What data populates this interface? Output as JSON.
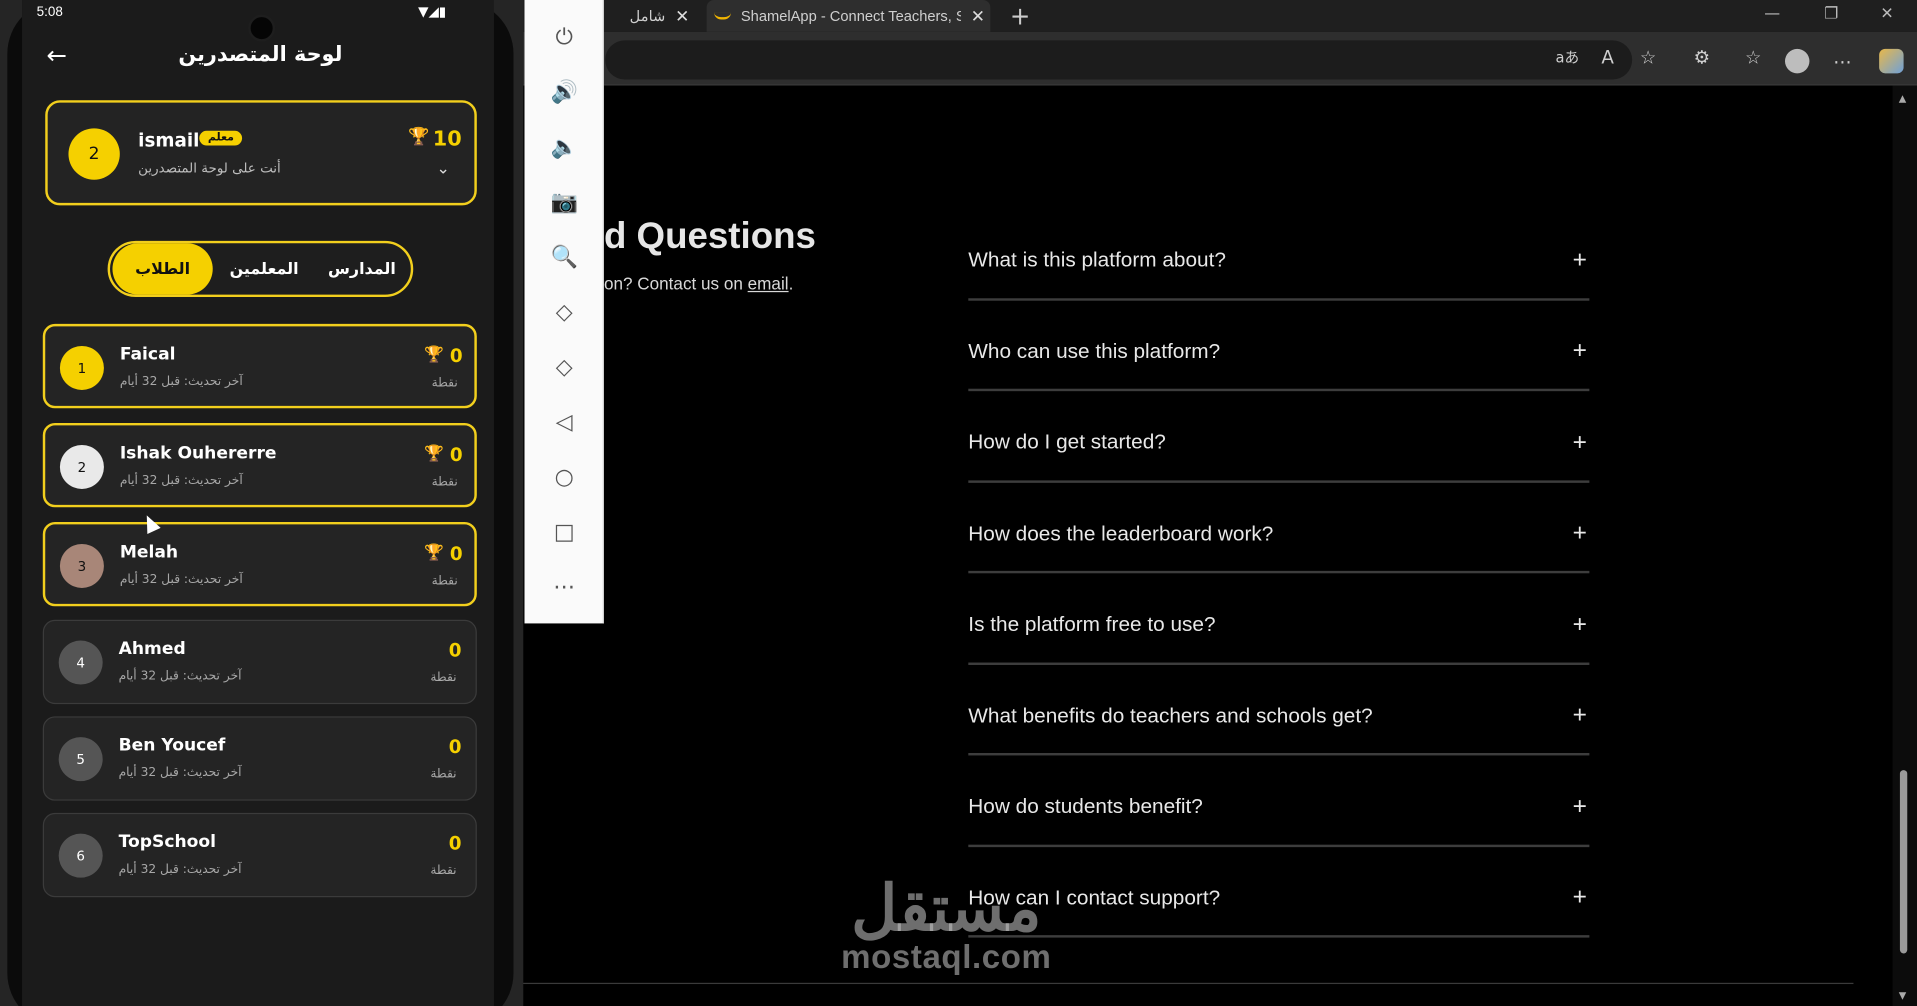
{
  "browser": {
    "tabs": [
      {
        "label": "شامل",
        "close": "✕"
      },
      {
        "label": "ShamelApp - Connect Teachers, S",
        "close": "✕"
      }
    ],
    "new_tab": "+",
    "window_controls": {
      "minimize": "—",
      "restore": "❐",
      "close": "✕"
    },
    "toolbar_icons": [
      "aあ",
      "A",
      "☆",
      "⚙",
      "☆",
      "…"
    ]
  },
  "faq": {
    "title": "d Questions",
    "subtitle_prefix": "on? Contact us on ",
    "subtitle_link": "email",
    "subtitle_suffix": ".",
    "items": [
      "What is this platform about?",
      "Who can use this platform?",
      "How do I get started?",
      "How does the leaderboard work?",
      "Is the platform free to use?",
      "What benefits do teachers and schools get?",
      "How do students benefit?",
      "How can I contact support?"
    ],
    "expand_glyph": "+"
  },
  "watermark": {
    "arabic": "مستقل",
    "latin": "mostaql.com"
  },
  "emulator": {
    "buttons": [
      "⏻",
      "🔊",
      "🔈",
      "📷",
      "🔍",
      "◇",
      "◇",
      "◁",
      "○",
      "□",
      "⋯"
    ]
  },
  "phone": {
    "status": {
      "time": "5:08",
      "icons": "▼◢▮"
    },
    "title": "لوحة المتصدرين",
    "back_glyph": "←",
    "me": {
      "rank": "2",
      "name": "ismail",
      "badge": "معلم",
      "subtitle": "أنت على لوحة المتصدرين",
      "points": "10",
      "trophy": "🏆",
      "chevron": "⌄"
    },
    "segments": [
      "الطلاب",
      "المعلمين",
      "المدارس"
    ],
    "rows": [
      {
        "rank": "1",
        "name": "Faical",
        "updated": "آخر تحديث: قبل 32 أيام",
        "score": "0",
        "unit": "نقطة",
        "trophy": "🏆",
        "rank_color": "#f5d000",
        "trophy_color": "#f2c200"
      },
      {
        "rank": "2",
        "name": "Ishak Ouhererre",
        "updated": "آخر تحديث: قبل 32 أيام",
        "score": "0",
        "unit": "نقطة",
        "trophy": "🏆",
        "rank_color": "#e9e9e9",
        "trophy_color": "#e6e6e6"
      },
      {
        "rank": "3",
        "name": "Melah",
        "updated": "آخر تحديث: قبل 32 أيام",
        "score": "0",
        "unit": "نقطة",
        "trophy": "🏆",
        "rank_color": "#a88678",
        "trophy_color": "#a0a0a0"
      },
      {
        "rank": "4",
        "name": "Ahmed",
        "updated": "آخر تحديث: قبل 32 أيام",
        "score": "0",
        "unit": "نقطة",
        "trophy": "",
        "rank_color": "#555555",
        "trophy_color": "#555555"
      },
      {
        "rank": "5",
        "name": "Ben Youcef",
        "updated": "آخر تحديث: قبل 32 أيام",
        "score": "0",
        "unit": "نقطة",
        "trophy": "",
        "rank_color": "#555555",
        "trophy_color": "#555555"
      },
      {
        "rank": "6",
        "name": "TopSchool",
        "updated": "آخر تحديث: قبل 32 أيام",
        "score": "0",
        "unit": "نقطة",
        "trophy": "",
        "rank_color": "#555555",
        "trophy_color": "#555555"
      }
    ]
  },
  "colors": {
    "accent": "#f5d000",
    "page_bg": "#000000"
  }
}
